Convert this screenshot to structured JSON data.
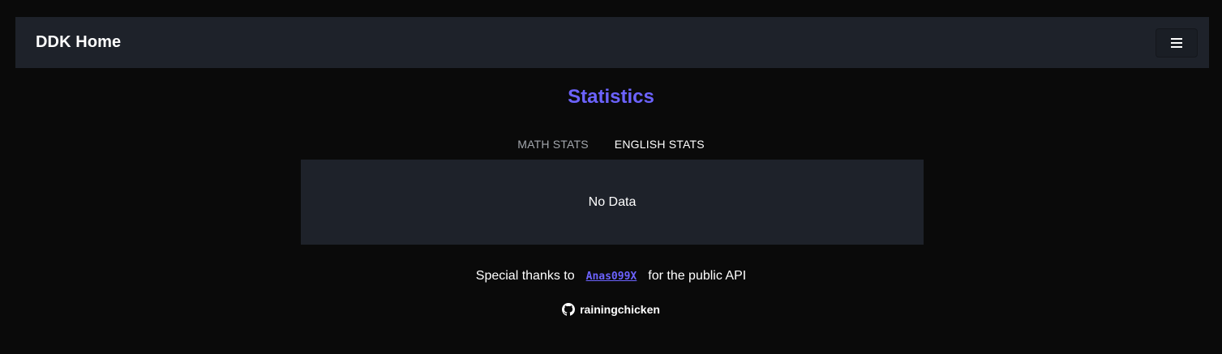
{
  "navbar": {
    "brand": "DDK Home",
    "menu_icon": "hamburger-menu-icon"
  },
  "page": {
    "title": "Statistics"
  },
  "tabs": [
    {
      "label": "MATH STATS",
      "active": false
    },
    {
      "label": "ENGLISH STATS",
      "active": true
    }
  ],
  "panel": {
    "message": "No Data"
  },
  "footer": {
    "thanks_prefix": "Special thanks to",
    "thanks_link": "Anas099X",
    "thanks_suffix": "for the public API",
    "author_icon": "github-icon",
    "author": "rainingchicken"
  },
  "colors": {
    "background": "#0a0a0a",
    "surface": "#1e222a",
    "accent": "#6c63ff",
    "inactive_tab": "#a3a7ad"
  }
}
